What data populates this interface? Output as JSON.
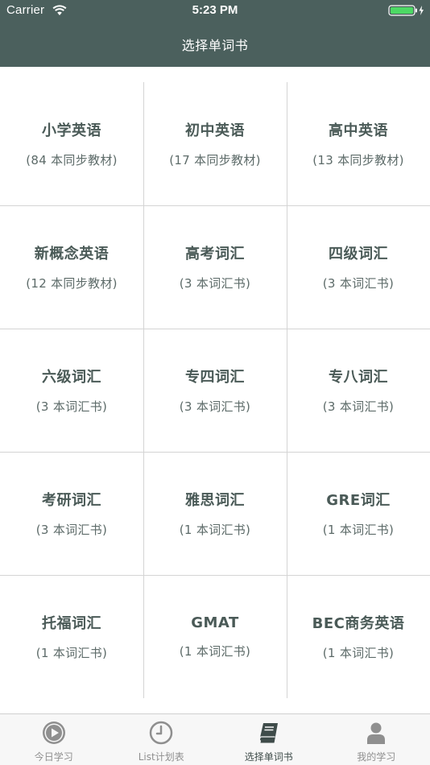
{
  "status_bar": {
    "carrier": "Carrier",
    "time": "5:23 PM"
  },
  "nav": {
    "title": "选择单词书"
  },
  "books": [
    {
      "title": "小学英语",
      "count": "(84 本同步教材)"
    },
    {
      "title": "初中英语",
      "count": "(17 本同步教材)"
    },
    {
      "title": "高中英语",
      "count": "(13 本同步教材)"
    },
    {
      "title": "新概念英语",
      "count": "(12 本同步教材)"
    },
    {
      "title": "高考词汇",
      "count": "(3 本词汇书)"
    },
    {
      "title": "四级词汇",
      "count": "(3 本词汇书)"
    },
    {
      "title": "六级词汇",
      "count": "(3 本词汇书)"
    },
    {
      "title": "专四词汇",
      "count": "(3 本词汇书)"
    },
    {
      "title": "专八词汇",
      "count": "(3 本词汇书)"
    },
    {
      "title": "考研词汇",
      "count": "(3 本词汇书)"
    },
    {
      "title": "雅思词汇",
      "count": "(1 本词汇书)"
    },
    {
      "title": "GRE词汇",
      "count": "(1 本词汇书)"
    },
    {
      "title": "托福词汇",
      "count": "(1 本词汇书)"
    },
    {
      "title": "GMAT",
      "count": "(1 本词汇书)"
    },
    {
      "title": "BEC商务英语",
      "count": "(1 本词汇书)"
    }
  ],
  "tabs": [
    {
      "label": "今日学习",
      "icon": "play-icon"
    },
    {
      "label": "List计划表",
      "icon": "clock-icon"
    },
    {
      "label": "选择单词书",
      "icon": "book-icon"
    },
    {
      "label": "我的学习",
      "icon": "person-icon"
    }
  ],
  "colors": {
    "header": "#4b605d",
    "battery": "#4cd964",
    "active_tab": "#3f4c4a",
    "inactive_tab": "#8f8f8f"
  }
}
